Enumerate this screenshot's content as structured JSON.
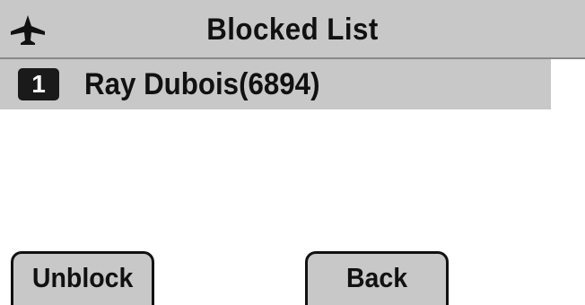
{
  "header": {
    "title": "Blocked List",
    "icon": "airplane-icon"
  },
  "blocked_list": {
    "items": [
      {
        "index": "1",
        "label": "Ray Dubois(6894)",
        "selected": true
      }
    ]
  },
  "softkeys": {
    "unblock_label": "Unblock",
    "back_label": "Back"
  },
  "colors": {
    "highlight": "#c8c8c8",
    "badge": "#1a1a1a",
    "text": "#111111"
  }
}
